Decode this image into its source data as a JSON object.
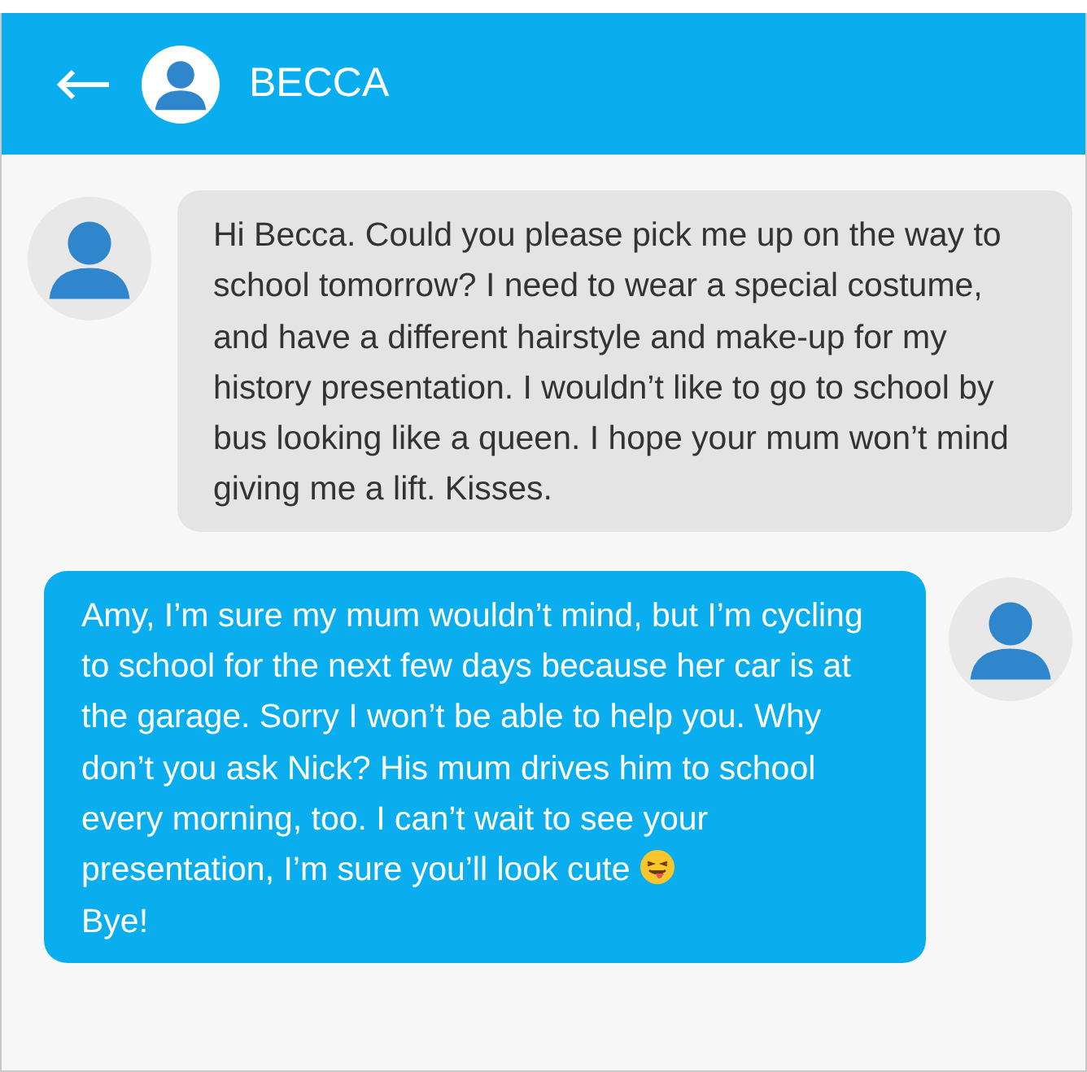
{
  "header": {
    "title": "BECCA"
  },
  "messages": [
    {
      "kind": "incoming",
      "parts": [
        {
          "kind": "text",
          "text": "Hi Becca. Could you please pick me up on the way to school tomorrow? I need to wear a special costume, and have a different hairstyle and make-up for my history presentation. I wouldn’t like to go to school by bus looking like a queen. I hope your mum won’t mind giving me a lift. Kisses."
        }
      ]
    },
    {
      "kind": "outgoing",
      "parts": [
        {
          "kind": "text",
          "text": "Amy, I’m sure my mum wouldn’t mind, but I’m cycling to school for the next few days because her car is at the garage. Sorry I won’t be able to help you. Why don’t you ask Nick? His mum drives him to school every morning, too. I can’t wait to see your"
        },
        {
          "kind": "text_emoji",
          "text": "presentation, I’m sure you’ll look cute"
        },
        {
          "kind": "text",
          "text": "Bye!"
        }
      ]
    }
  ]
}
